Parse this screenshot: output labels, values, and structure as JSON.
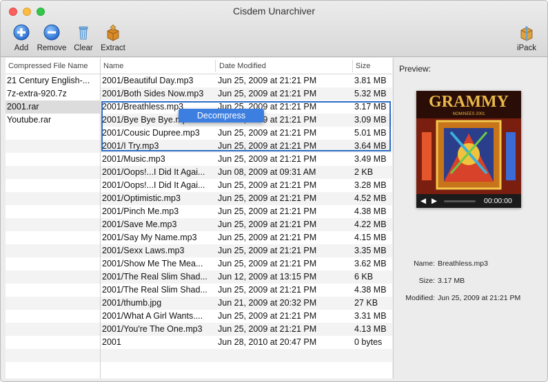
{
  "window": {
    "title": "Cisdem Unarchiver"
  },
  "toolbar": {
    "add": "Add",
    "remove": "Remove",
    "clear": "Clear",
    "extract": "Extract",
    "ipack": "iPack"
  },
  "left": {
    "header": "Compressed File Name",
    "items": [
      "21 Century English-...",
      "7z-extra-920.7z",
      "2001.rar",
      "Youtube.rar"
    ]
  },
  "main": {
    "headers": {
      "name": "Name",
      "date": "Date Modified",
      "size": "Size"
    },
    "rows": [
      {
        "name": "2001/Beautiful Day.mp3",
        "date": "Jun 25, 2009 at 21:21 PM",
        "size": "3.81 MB"
      },
      {
        "name": "2001/Both Sides Now.mp3",
        "date": "Jun 25, 2009 at 21:21 PM",
        "size": "5.32 MB"
      },
      {
        "name": "2001/Breathless.mp3",
        "date": "Jun 25, 2009 at 21:21 PM",
        "size": "3.17 MB"
      },
      {
        "name": "2001/Bye Bye Bye.mp3",
        "date": "Jun 25, 2009 at 21:21 PM",
        "size": "3.09 MB"
      },
      {
        "name": "2001/Cousic Dupree.mp3",
        "date": "Jun 25, 2009 at 21:21 PM",
        "size": "5.01 MB"
      },
      {
        "name": "2001/I Try.mp3",
        "date": "Jun 25, 2009 at 21:21 PM",
        "size": "3.64 MB"
      },
      {
        "name": "2001/Music.mp3",
        "date": "Jun 25, 2009 at 21:21 PM",
        "size": "3.49 MB"
      },
      {
        "name": "2001/Oops!...I Did It Agai...",
        "date": "Jun 08, 2009 at 09:31 AM",
        "size": "2 KB"
      },
      {
        "name": "2001/Oops!...I Did It Agai...",
        "date": "Jun 25, 2009 at 21:21 PM",
        "size": "3.28 MB"
      },
      {
        "name": "2001/Optimistic.mp3",
        "date": "Jun 25, 2009 at 21:21 PM",
        "size": "4.52 MB"
      },
      {
        "name": "2001/Pinch Me.mp3",
        "date": "Jun 25, 2009 at 21:21 PM",
        "size": "4.38 MB"
      },
      {
        "name": "2001/Save Me.mp3",
        "date": "Jun 25, 2009 at 21:21 PM",
        "size": "4.22 MB"
      },
      {
        "name": "2001/Say My Name.mp3",
        "date": "Jun 25, 2009 at 21:21 PM",
        "size": "4.15 MB"
      },
      {
        "name": "2001/Sexx Laws.mp3",
        "date": "Jun 25, 2009 at 21:21 PM",
        "size": "3.35 MB"
      },
      {
        "name": "2001/Show Me The Mea...",
        "date": "Jun 25, 2009 at 21:21 PM",
        "size": "3.62 MB"
      },
      {
        "name": "2001/The Real Slim Shad...",
        "date": "Jun 12, 2009 at 13:15 PM",
        "size": "6 KB"
      },
      {
        "name": "2001/The Real Slim Shad...",
        "date": "Jun 25, 2009 at 21:21 PM",
        "size": "4.38 MB"
      },
      {
        "name": "2001/thumb.jpg",
        "date": "Jun 21, 2009 at 20:32 PM",
        "size": "27 KB"
      },
      {
        "name": "2001/What A Girl Wants....",
        "date": "Jun 25, 2009 at 21:21 PM",
        "size": "3.31 MB"
      },
      {
        "name": "2001/You're The One.mp3",
        "date": "Jun 25, 2009 at 21:21 PM",
        "size": "4.13 MB"
      },
      {
        "name": "2001",
        "date": "Jun 28, 2010 at 20:47 PM",
        "size": "0 bytes"
      }
    ],
    "context_menu": "Decompress"
  },
  "preview": {
    "label": "Preview:",
    "album_text": "GRAMMY",
    "album_sub": "NOMINEES 2001",
    "player_time": "00:00:00",
    "meta": {
      "name_key": "Name:",
      "name_val": "Breathless.mp3",
      "size_key": "Size:",
      "size_val": "3.17 MB",
      "mod_key": "Modified:",
      "mod_val": "Jun 25, 2009 at 21:21 PM"
    }
  },
  "colors": {
    "selection": "#2b6cc4",
    "menu": "#3d7fe0"
  }
}
